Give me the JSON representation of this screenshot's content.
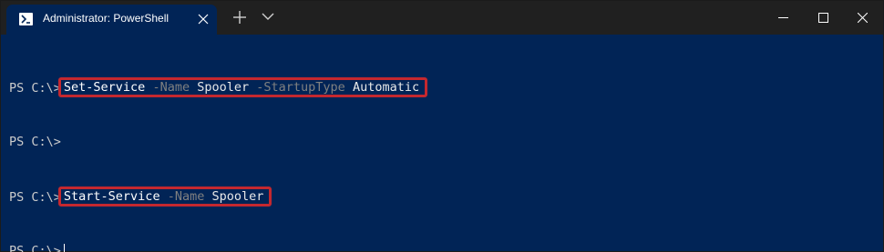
{
  "window": {
    "tab_title": "Administrator: PowerShell",
    "tab_icon": "powershell-icon",
    "controls": {
      "minimize": "minimize-icon",
      "maximize": "maximize-icon",
      "close": "close-icon"
    }
  },
  "terminal": {
    "prompt": "PS C:\\>",
    "lines": [
      {
        "prompt": "PS C:\\>",
        "command": "Set-Service",
        "parts": [
          {
            "type": "param",
            "text": "-Name"
          },
          {
            "type": "arg",
            "text": "Spooler"
          },
          {
            "type": "param",
            "text": "-StartupType"
          },
          {
            "type": "arg",
            "text": "Automatic"
          }
        ],
        "highlighted": true
      },
      {
        "prompt": "PS C:\\>",
        "command": "",
        "parts": [],
        "highlighted": false
      },
      {
        "prompt": "PS C:\\>",
        "command": "Start-Service",
        "parts": [
          {
            "type": "param",
            "text": "-Name"
          },
          {
            "type": "arg",
            "text": "Spooler"
          }
        ],
        "highlighted": true
      },
      {
        "prompt": "PS C:\\>",
        "command": "",
        "parts": [],
        "highlighted": false,
        "cursor": true
      }
    ]
  },
  "colors": {
    "background": "#012456",
    "titlebar": "#202020",
    "highlight_border": "#c4282f",
    "parameter": "#808080"
  }
}
